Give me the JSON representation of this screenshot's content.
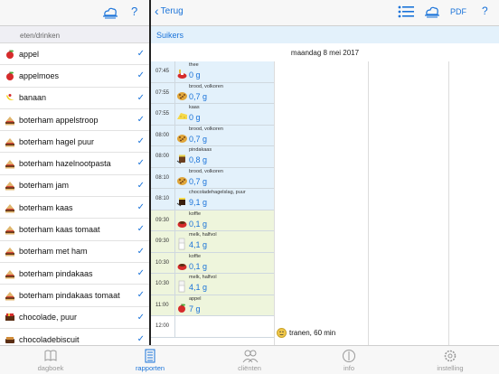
{
  "left_nav": {
    "help": "?"
  },
  "section_header": "eten/drinken",
  "foods": [
    {
      "label": "appel",
      "icon": "apple-icon"
    },
    {
      "label": "appelmoes",
      "icon": "apple-icon"
    },
    {
      "label": "banaan",
      "icon": "banana-icon"
    },
    {
      "label": "boterham appelstroop",
      "icon": "sandwich-icon"
    },
    {
      "label": "boterham hagel puur",
      "icon": "sandwich-icon"
    },
    {
      "label": "boterham hazelnootpasta",
      "icon": "sandwich-icon"
    },
    {
      "label": "boterham jam",
      "icon": "sandwich-icon"
    },
    {
      "label": "boterham kaas",
      "icon": "sandwich-icon"
    },
    {
      "label": "boterham kaas tomaat",
      "icon": "sandwich-icon"
    },
    {
      "label": "boterham met ham",
      "icon": "sandwich-icon"
    },
    {
      "label": "boterham pindakaas",
      "icon": "sandwich-icon"
    },
    {
      "label": "boterham pindakaas tomaat",
      "icon": "sandwich-icon"
    },
    {
      "label": "chocolade, puur",
      "icon": "chocolate-icon"
    },
    {
      "label": "chocoladebiscuit",
      "icon": "biscuit-icon"
    }
  ],
  "right_nav": {
    "back": "Terug",
    "pdf": "PDF",
    "help": "?"
  },
  "subtitle": "Suikers",
  "date": "maandag 8 mei 2017",
  "entries": [
    {
      "time": "07:45",
      "name": "thee",
      "value": "0 g",
      "kind": "drink_food",
      "icon": "tea-icon"
    },
    {
      "time": "07:55",
      "name": "brood, volkoren",
      "value": "0,7 g",
      "kind": "food",
      "icon": "bread-icon"
    },
    {
      "time": "07:55",
      "name": "kaas",
      "value": "0 g",
      "kind": "food",
      "icon": "cheese-icon"
    },
    {
      "time": "08:00",
      "name": "brood, volkoren",
      "value": "0,7 g",
      "kind": "food",
      "icon": "bread-icon"
    },
    {
      "time": "08:00",
      "name": "pindakaas",
      "value": "0,8 g",
      "kind": "food",
      "icon": "peanut-butter-icon"
    },
    {
      "time": "08:10",
      "name": "brood, volkoren",
      "value": "0,7 g",
      "kind": "food",
      "icon": "bread-icon"
    },
    {
      "time": "08:10",
      "name": "chocoladehagelslag, puur",
      "value": "9,1 g",
      "kind": "food",
      "icon": "chocolate-sprinkles-icon"
    },
    {
      "time": "09:30",
      "name": "koffie",
      "value": "0,1 g",
      "kind": "drink",
      "icon": "coffee-icon"
    },
    {
      "time": "09:30",
      "name": "melk, halfvol",
      "value": "4,1 g",
      "kind": "drink",
      "icon": "milk-icon"
    },
    {
      "time": "10:30",
      "name": "koffie",
      "value": "0,1 g",
      "kind": "drink",
      "icon": "coffee-icon"
    },
    {
      "time": "10:30",
      "name": "melk, halfvol",
      "value": "4,1 g",
      "kind": "drink",
      "icon": "milk-icon"
    },
    {
      "time": "11:00",
      "name": "appel",
      "value": "7 g",
      "kind": "drink",
      "icon": "apple-icon"
    },
    {
      "time": "12:00",
      "name": "",
      "value": "",
      "kind": "plain",
      "icon": ""
    }
  ],
  "note": {
    "text": "tranen, 60 min",
    "icon": "smiley-icon"
  },
  "tabs": [
    {
      "label": "dagboek",
      "icon": "book-icon",
      "active": false
    },
    {
      "label": "rapporten",
      "icon": "report-icon",
      "active": true
    },
    {
      "label": "cliënten",
      "icon": "clients-icon",
      "active": false
    },
    {
      "label": "info",
      "icon": "info-icon",
      "active": false
    },
    {
      "label": "instelling",
      "icon": "gear-icon",
      "active": false
    }
  ],
  "colors": {
    "accent": "#1a73d9",
    "food_bg": "#e3f1fb",
    "drink_bg": "#eef5dc"
  }
}
